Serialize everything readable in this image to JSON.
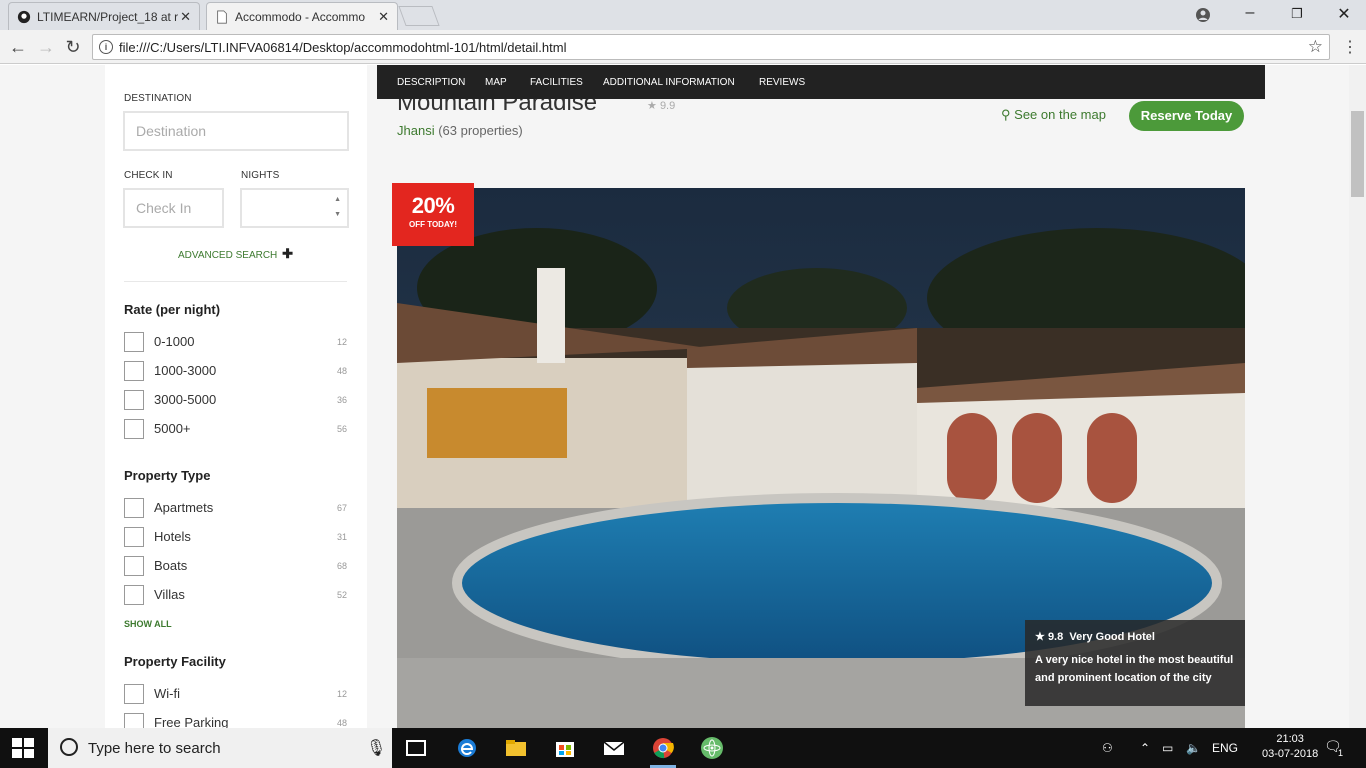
{
  "browser": {
    "tabs": [
      {
        "title": "LTIMEARN/Project_18 at r",
        "active": false
      },
      {
        "title": "Accommodo - Accommo",
        "active": true
      }
    ],
    "url": "file:///C:/Users/LTI.INFVA06814/Desktop/accommodohtml-101/html/detail.html"
  },
  "sidebar": {
    "destination_label": "DESTINATION",
    "destination_placeholder": "Destination",
    "checkin_label": "CHECK IN",
    "checkin_placeholder": "Check In",
    "nights_label": "NIGHTS",
    "advanced_search": "ADVANCED SEARCH",
    "rate_title": "Rate (per night)",
    "rates": [
      {
        "label": "0-1000",
        "count": "12"
      },
      {
        "label": "1000-3000",
        "count": "48"
      },
      {
        "label": "3000-5000",
        "count": "36"
      },
      {
        "label": "5000+",
        "count": "56"
      }
    ],
    "type_title": "Property Type",
    "types": [
      {
        "label": "Apartmets",
        "count": "67"
      },
      {
        "label": "Hotels",
        "count": "31"
      },
      {
        "label": "Boats",
        "count": "68"
      },
      {
        "label": "Villas",
        "count": "52"
      }
    ],
    "show_all": "SHOW ALL",
    "facility_title": "Property Facility",
    "facilities": [
      {
        "label": "Wi-fi",
        "count": "12"
      },
      {
        "label": "Free Parking",
        "count": "48"
      }
    ]
  },
  "subnav": [
    "DESCRIPTION",
    "MAP",
    "FACILITIES",
    "ADDITIONAL INFORMATION",
    "REVIEWS"
  ],
  "hotel": {
    "name": "Mountain Paradise",
    "rating": "9.9",
    "city": "Jhansi",
    "properties": "(63 properties)",
    "see_map": "See on the map",
    "reserve": "Reserve Today",
    "discount_pct": "20%",
    "discount_text": "OFF TODAY!",
    "review_score": "9.8",
    "review_label": "Very Good Hotel",
    "review_text": "A very nice hotel in the most beautiful and prominent location of the city"
  },
  "taskbar": {
    "search_placeholder": "Type here to search",
    "lang": "ENG",
    "time": "21:03",
    "date": "03-07-2018",
    "notif_count": "1"
  },
  "colors": {
    "accent_green": "#4c9a3a",
    "link_green": "#3d7a2f",
    "discount_red": "#e3261f",
    "subnav_bg": "#222222"
  }
}
